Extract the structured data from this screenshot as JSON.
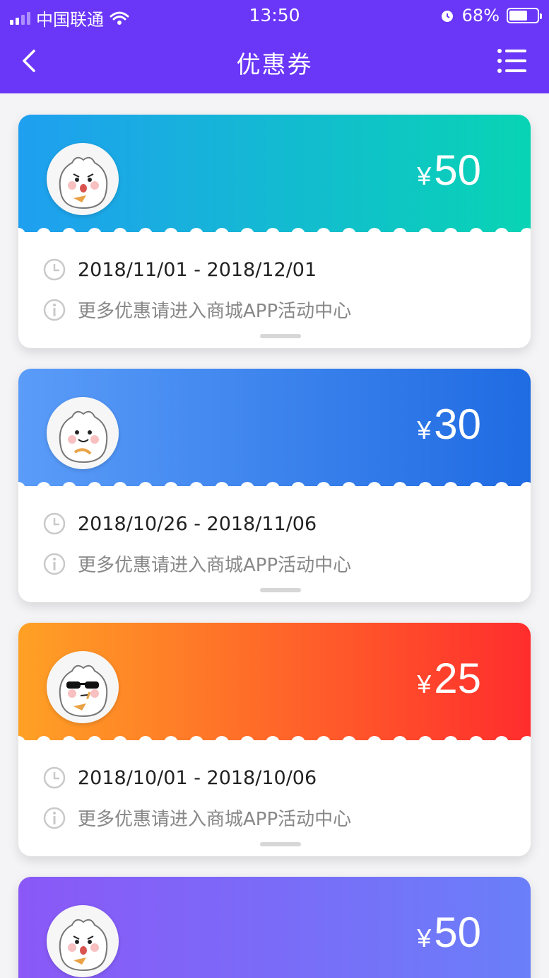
{
  "status_bar": {
    "carrier": "中国联通",
    "time": "13:50",
    "battery": "68%"
  },
  "nav": {
    "title": "优惠券"
  },
  "coupons": [
    {
      "currency": "¥",
      "amount": "50",
      "dates": "2018/11/01 -  2018/12/01",
      "note": "更多优惠请进入商城APP活动中心",
      "gradient_from": "#1f9ff0",
      "gradient_to": "#08d4b4"
    },
    {
      "currency": "¥",
      "amount": "30",
      "dates": "2018/10/26 -  2018/11/06",
      "note": "更多优惠请进入商城APP活动中心",
      "gradient_from": "#5a9cf8",
      "gradient_to": "#1f6be2"
    },
    {
      "currency": "¥",
      "amount": "25",
      "dates": "2018/10/01 -  2018/10/06",
      "note": "更多优惠请进入商城APP活动中心",
      "gradient_from": "#ffa125",
      "gradient_to": "#ff2d2d"
    },
    {
      "currency": "¥",
      "amount": "50",
      "gradient_from": "#8a58f7",
      "gradient_to": "#6a7ff9"
    }
  ]
}
